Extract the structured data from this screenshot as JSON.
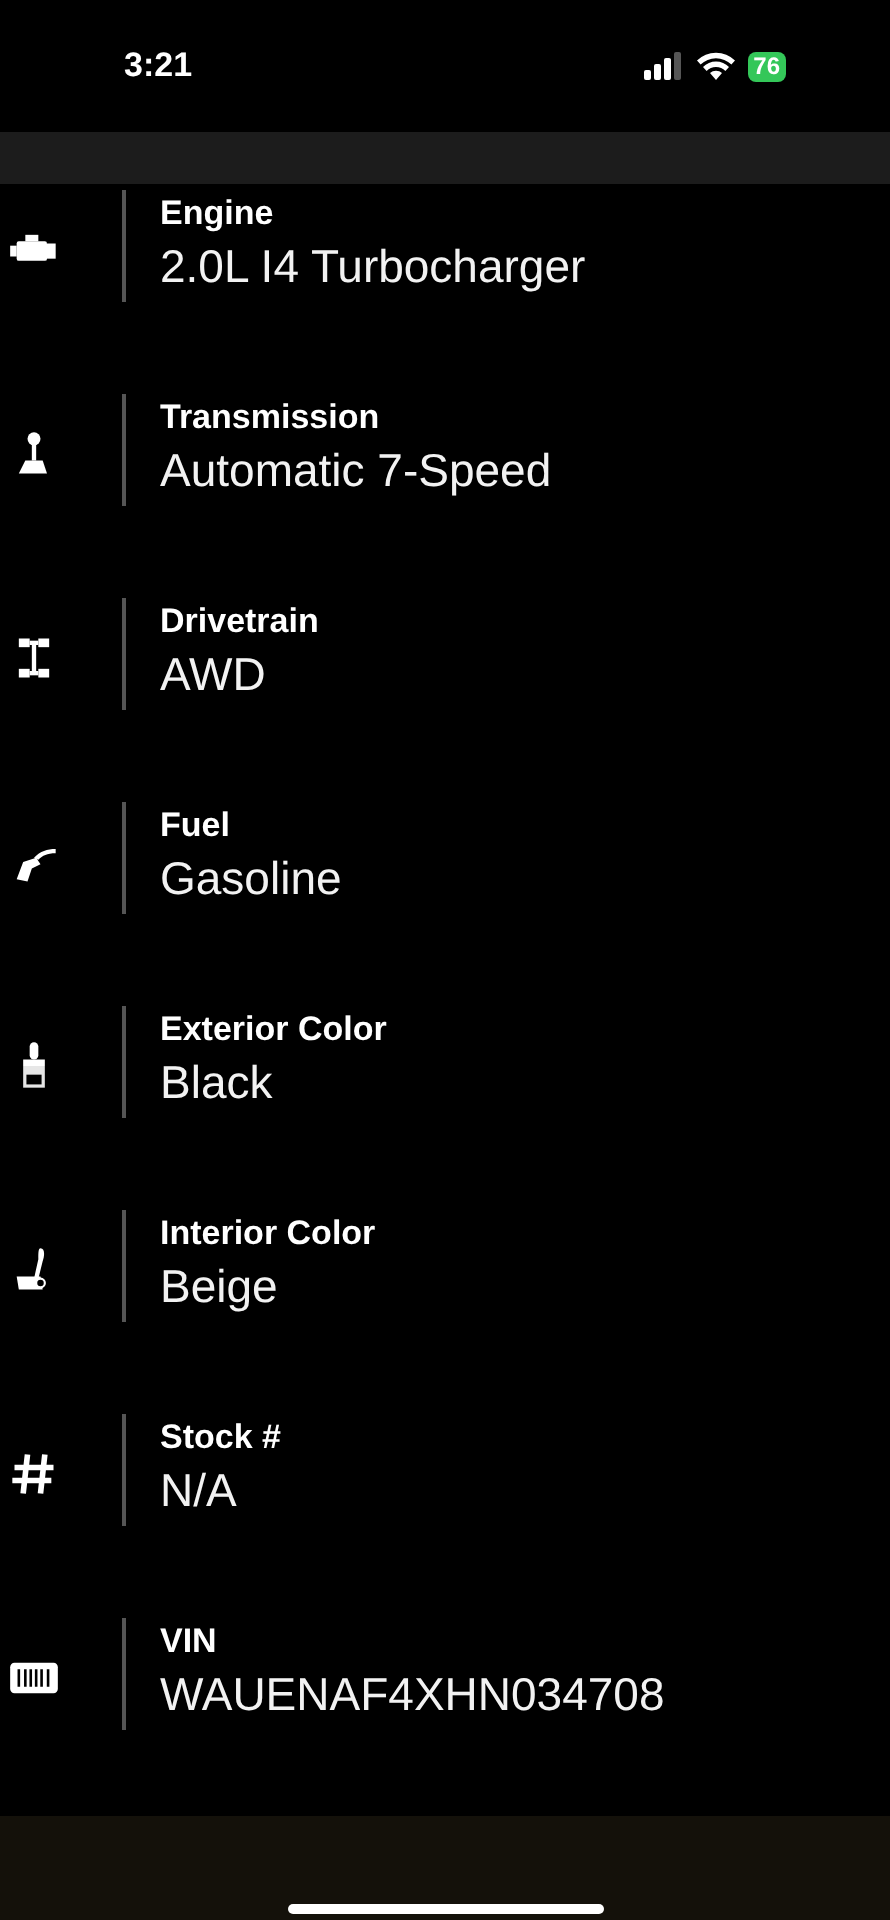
{
  "status_bar": {
    "time": "3:21",
    "battery": "76"
  },
  "specs": [
    {
      "kind": "engine",
      "label": "Engine",
      "value": "2.0L I4 Turbocharger"
    },
    {
      "kind": "shifter",
      "label": "Transmission",
      "value": "Automatic 7-Speed"
    },
    {
      "kind": "drivetrain",
      "label": "Drivetrain",
      "value": "AWD"
    },
    {
      "kind": "fuel",
      "label": "Fuel",
      "value": "Gasoline"
    },
    {
      "kind": "paint",
      "label": "Exterior Color",
      "value": "Black"
    },
    {
      "kind": "seat",
      "label": "Interior Color",
      "value": "Beige"
    },
    {
      "kind": "hash",
      "label": "Stock #",
      "value": "N/A"
    },
    {
      "kind": "barcode",
      "label": "VIN",
      "value": "WAUENAF4XHN034708"
    }
  ]
}
